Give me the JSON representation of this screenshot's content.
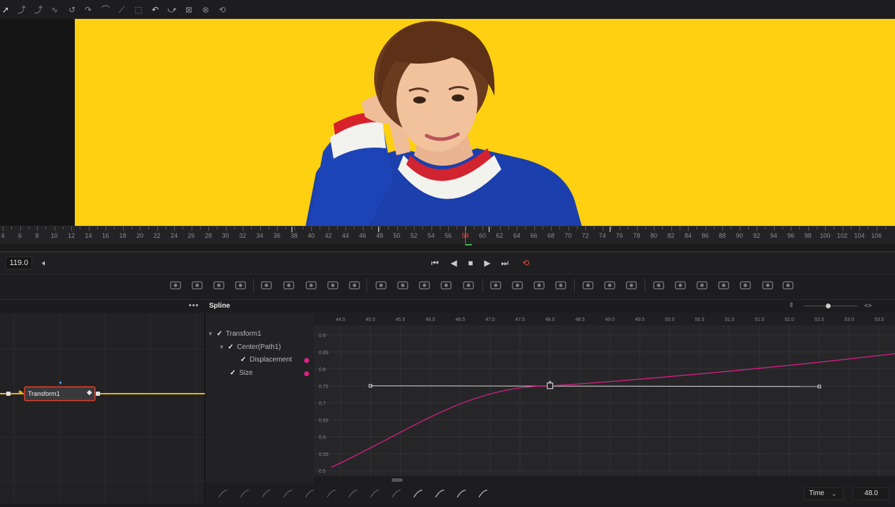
{
  "transport": {
    "current_frame": "119.0"
  },
  "ruler": {
    "labels": [
      "4",
      "6",
      "8",
      "10",
      "12",
      "14",
      "16",
      "18",
      "20",
      "22",
      "24",
      "26",
      "28",
      "30",
      "32",
      "34",
      "36",
      "38",
      "40",
      "42",
      "44",
      "46",
      "48",
      "50",
      "52",
      "54",
      "56",
      "58",
      "60",
      "62",
      "64",
      "66",
      "68",
      "70",
      "72",
      "74",
      "76",
      "78",
      "80",
      "82",
      "84",
      "86",
      "88",
      "90",
      "92",
      "94",
      "96",
      "98",
      "100",
      "102",
      "104",
      "106"
    ],
    "playhead": "58"
  },
  "spline": {
    "title": "Spline",
    "x_labels": [
      "44.5",
      "45.0",
      "45.5",
      "46.0",
      "46.5",
      "47.0",
      "47.5",
      "48.0",
      "48.5",
      "49.0",
      "49.5",
      "50.0",
      "50.5",
      "51.0",
      "51.5",
      "52.0",
      "52.5",
      "53.0",
      "53.5"
    ],
    "y_labels": [
      "0.9",
      "0.85",
      "0.8",
      "0.75",
      "0.7",
      "0.65",
      "0.6",
      "0.55",
      "0.5"
    ]
  },
  "tree": {
    "items": [
      {
        "label": "Transform1"
      },
      {
        "label": "Center(Path1)"
      },
      {
        "label": "Displacement"
      },
      {
        "label": "Size"
      }
    ]
  },
  "nodes": {
    "node_label": "Transform1"
  },
  "bottom": {
    "time_mode": "Time",
    "time_value": "48.0"
  },
  "colors": {
    "viewer_bg": "#fdd011",
    "spline_curve": "#d81f85",
    "node_link": "#e8b416",
    "playhead": "#e24a3a"
  }
}
